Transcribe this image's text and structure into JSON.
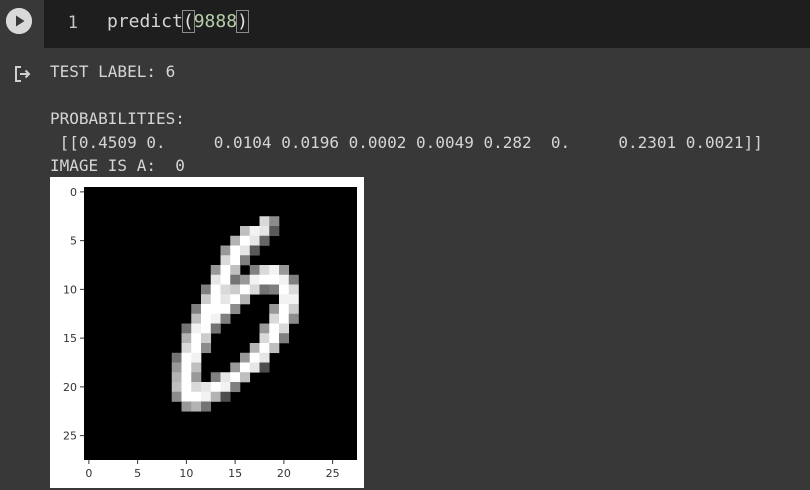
{
  "cell": {
    "line_number": "1",
    "code": {
      "function": "predict",
      "open_paren": "(",
      "argument": "9888",
      "close_paren": ")"
    }
  },
  "output": {
    "test_label": "TEST LABEL: 6",
    "probabilities_heading": "PROBABILITIES:",
    "probabilities_values": " [[0.4509 0.     0.0104 0.0196 0.0002 0.0049 0.282  0.     0.2301 0.0021]]",
    "prediction": "IMAGE IS A:  0"
  },
  "chart_data": {
    "type": "heatmap",
    "colormap": "gray",
    "grid": false,
    "xlim": [
      -0.5,
      27.5
    ],
    "ylim": [
      27.5,
      -0.5
    ],
    "x_ticks": [
      "0",
      "5",
      "10",
      "15",
      "20",
      "25"
    ],
    "y_ticks": [
      "0",
      "5",
      "10",
      "15",
      "20",
      "25"
    ],
    "rows": 28,
    "cols": 28,
    "nonzero_pixels": [
      [
        3,
        18,
        0.85
      ],
      [
        3,
        19,
        0.55
      ],
      [
        4,
        16,
        0.75
      ],
      [
        4,
        17,
        0.95
      ],
      [
        4,
        18,
        0.9
      ],
      [
        4,
        19,
        0.35
      ],
      [
        5,
        15,
        0.7
      ],
      [
        5,
        16,
        1.0
      ],
      [
        5,
        17,
        0.9
      ],
      [
        5,
        18,
        0.4
      ],
      [
        6,
        14,
        0.6
      ],
      [
        6,
        15,
        1.0
      ],
      [
        6,
        16,
        0.9
      ],
      [
        6,
        17,
        0.35
      ],
      [
        7,
        14,
        0.85
      ],
      [
        7,
        15,
        1.0
      ],
      [
        7,
        16,
        0.5
      ],
      [
        8,
        13,
        0.6
      ],
      [
        8,
        14,
        1.0
      ],
      [
        8,
        15,
        0.75
      ],
      [
        8,
        17,
        0.5
      ],
      [
        8,
        18,
        0.85
      ],
      [
        8,
        19,
        0.95
      ],
      [
        8,
        20,
        0.6
      ],
      [
        9,
        13,
        0.9
      ],
      [
        9,
        14,
        1.0
      ],
      [
        9,
        15,
        0.45
      ],
      [
        9,
        16,
        0.6
      ],
      [
        9,
        17,
        0.95
      ],
      [
        9,
        18,
        1.0
      ],
      [
        9,
        19,
        1.0
      ],
      [
        9,
        20,
        0.95
      ],
      [
        9,
        21,
        0.5
      ],
      [
        10,
        12,
        0.5
      ],
      [
        10,
        13,
        1.0
      ],
      [
        10,
        14,
        0.85
      ],
      [
        10,
        15,
        0.8
      ],
      [
        10,
        16,
        1.0
      ],
      [
        10,
        17,
        0.85
      ],
      [
        10,
        18,
        0.45
      ],
      [
        10,
        19,
        0.5
      ],
      [
        10,
        20,
        1.0
      ],
      [
        10,
        21,
        0.85
      ],
      [
        11,
        12,
        0.8
      ],
      [
        11,
        13,
        1.0
      ],
      [
        11,
        14,
        0.9
      ],
      [
        11,
        15,
        1.0
      ],
      [
        11,
        16,
        0.7
      ],
      [
        11,
        20,
        0.95
      ],
      [
        11,
        21,
        0.95
      ],
      [
        12,
        11,
        0.5
      ],
      [
        12,
        12,
        1.0
      ],
      [
        12,
        13,
        1.0
      ],
      [
        12,
        14,
        1.0
      ],
      [
        12,
        15,
        0.55
      ],
      [
        12,
        19,
        0.6
      ],
      [
        12,
        20,
        1.0
      ],
      [
        12,
        21,
        0.8
      ],
      [
        13,
        11,
        0.75
      ],
      [
        13,
        12,
        1.0
      ],
      [
        13,
        13,
        0.95
      ],
      [
        13,
        14,
        0.5
      ],
      [
        13,
        19,
        0.85
      ],
      [
        13,
        20,
        1.0
      ],
      [
        13,
        21,
        0.55
      ],
      [
        14,
        10,
        0.45
      ],
      [
        14,
        11,
        0.95
      ],
      [
        14,
        12,
        1.0
      ],
      [
        14,
        13,
        0.45
      ],
      [
        14,
        18,
        0.6
      ],
      [
        14,
        19,
        1.0
      ],
      [
        14,
        20,
        0.85
      ],
      [
        15,
        10,
        0.7
      ],
      [
        15,
        11,
        1.0
      ],
      [
        15,
        12,
        0.8
      ],
      [
        15,
        18,
        0.85
      ],
      [
        15,
        19,
        1.0
      ],
      [
        15,
        20,
        0.5
      ],
      [
        16,
        10,
        0.85
      ],
      [
        16,
        11,
        1.0
      ],
      [
        16,
        12,
        0.55
      ],
      [
        16,
        17,
        0.7
      ],
      [
        16,
        18,
        1.0
      ],
      [
        16,
        19,
        0.75
      ],
      [
        17,
        9,
        0.45
      ],
      [
        17,
        10,
        1.0
      ],
      [
        17,
        11,
        0.95
      ],
      [
        17,
        16,
        0.6
      ],
      [
        17,
        17,
        1.0
      ],
      [
        17,
        18,
        0.9
      ],
      [
        18,
        9,
        0.6
      ],
      [
        18,
        10,
        1.0
      ],
      [
        18,
        11,
        0.75
      ],
      [
        18,
        15,
        0.6
      ],
      [
        18,
        16,
        1.0
      ],
      [
        18,
        17,
        0.9
      ],
      [
        18,
        18,
        0.3
      ],
      [
        19,
        9,
        0.7
      ],
      [
        19,
        10,
        1.0
      ],
      [
        19,
        11,
        0.6
      ],
      [
        19,
        13,
        0.5
      ],
      [
        19,
        14,
        0.9
      ],
      [
        19,
        15,
        1.0
      ],
      [
        19,
        16,
        0.75
      ],
      [
        20,
        9,
        0.75
      ],
      [
        20,
        10,
        1.0
      ],
      [
        20,
        11,
        0.85
      ],
      [
        20,
        12,
        0.9
      ],
      [
        20,
        13,
        1.0
      ],
      [
        20,
        14,
        0.95
      ],
      [
        20,
        15,
        0.5
      ],
      [
        21,
        9,
        0.55
      ],
      [
        21,
        10,
        1.0
      ],
      [
        21,
        11,
        1.0
      ],
      [
        21,
        12,
        0.95
      ],
      [
        21,
        13,
        0.7
      ],
      [
        21,
        14,
        0.3
      ],
      [
        22,
        10,
        0.6
      ],
      [
        22,
        11,
        0.7
      ],
      [
        22,
        12,
        0.45
      ]
    ]
  }
}
